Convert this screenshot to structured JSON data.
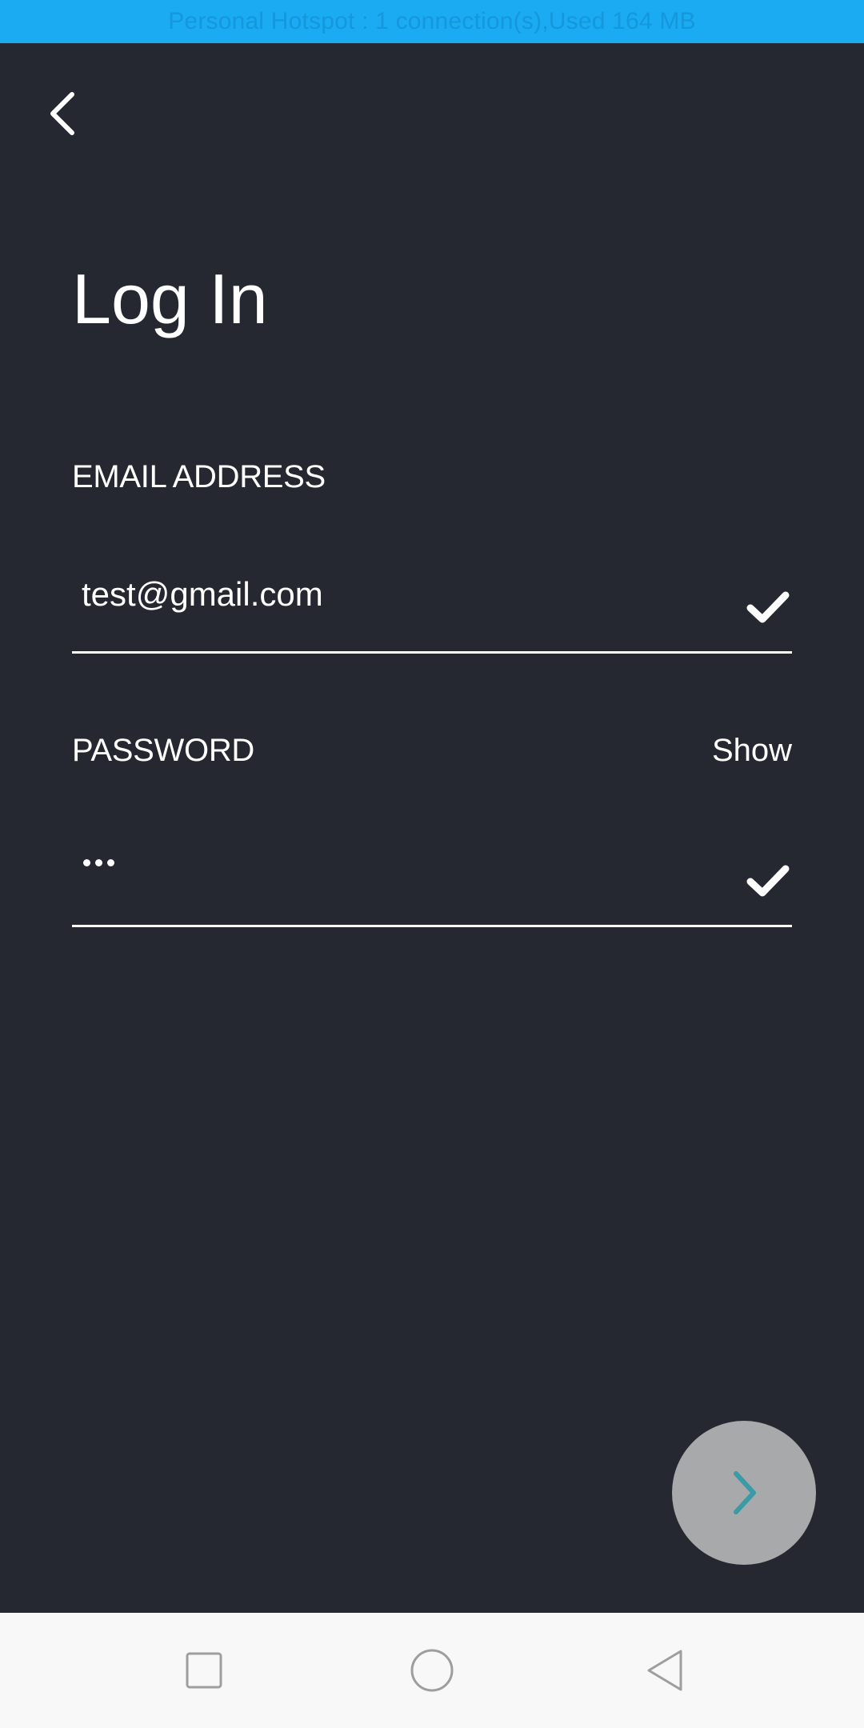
{
  "status_bar": {
    "text": "Personal Hotspot : 1 connection(s),Used  164 MB"
  },
  "header": {
    "back_icon": "chevron-left-icon"
  },
  "page": {
    "title": "Log In"
  },
  "form": {
    "email": {
      "label": "EMAIL ADDRESS",
      "value": "test@gmail.com",
      "valid_icon": "checkmark-icon"
    },
    "password": {
      "label": "PASSWORD",
      "show_label": "Show",
      "masked_length": 3,
      "valid_icon": "checkmark-icon"
    }
  },
  "next_button": {
    "icon": "chevron-right-icon"
  },
  "nav_bar": {
    "items": [
      "recent-apps-icon",
      "home-icon",
      "back-triangle-icon"
    ]
  },
  "colors": {
    "status_bar": "#1aabf2",
    "background": "#252830",
    "text": "#ffffff",
    "fab_background": "#a8a9aa",
    "fab_icon": "#3a9aa6",
    "nav_bar": "#f8f8f8",
    "nav_icons": "#9e9e9e"
  }
}
